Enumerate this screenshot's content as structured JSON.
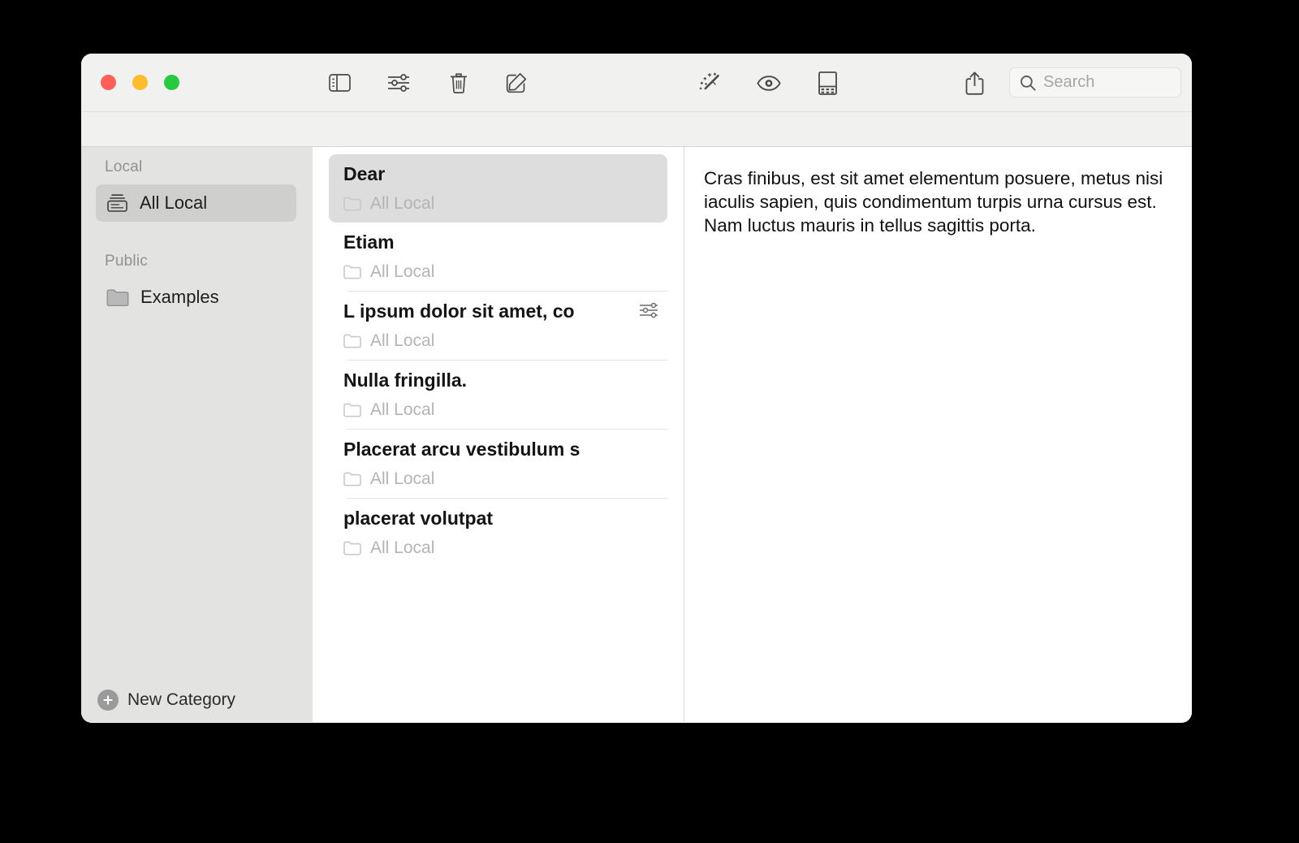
{
  "window": {
    "traffic_lights": [
      {
        "name": "close",
        "color": "#ff5f57"
      },
      {
        "name": "minimize",
        "color": "#febc2e"
      },
      {
        "name": "zoom",
        "color": "#28c840"
      }
    ]
  },
  "toolbar": {
    "buttons": [
      {
        "name": "toggle-sidebar",
        "icon": "sidebar-icon"
      },
      {
        "name": "filter",
        "icon": "sliders-icon"
      },
      {
        "name": "delete",
        "icon": "trash-icon"
      },
      {
        "name": "new-note",
        "icon": "compose-icon"
      },
      {
        "name": "magic",
        "icon": "magic-wand-icon"
      },
      {
        "name": "preview",
        "icon": "eye-icon"
      },
      {
        "name": "keyboard",
        "icon": "note-keyboard-icon"
      },
      {
        "name": "share",
        "icon": "share-icon"
      }
    ],
    "search": {
      "placeholder": "Search",
      "value": "",
      "icon": "search-icon"
    }
  },
  "sidebar": {
    "sections": [
      {
        "title": "Local",
        "items": [
          {
            "label": "All Local",
            "icon": "archive-tray-icon",
            "selected": true
          }
        ]
      },
      {
        "title": "Public",
        "items": [
          {
            "label": "Examples",
            "icon": "folder-icon",
            "selected": false
          }
        ]
      }
    ],
    "new_category": {
      "label": "New Category",
      "icon": "plus-circle-icon"
    }
  },
  "list": {
    "items": [
      {
        "title": "Dear",
        "folder": "All Local",
        "selected": true,
        "has_filter_icon": false
      },
      {
        "title": "Etiam",
        "folder": "All Local",
        "selected": false,
        "has_filter_icon": false
      },
      {
        "title": "L ipsum dolor sit amet, co",
        "folder": "All Local",
        "selected": false,
        "has_filter_icon": true
      },
      {
        "title": "Nulla fringilla.",
        "folder": "All Local",
        "selected": false,
        "has_filter_icon": false
      },
      {
        "title": "Placerat arcu vestibulum s",
        "folder": "All Local",
        "selected": false,
        "has_filter_icon": false
      },
      {
        "title": "placerat volutpat",
        "folder": "All Local",
        "selected": false,
        "has_filter_icon": false
      }
    ]
  },
  "detail": {
    "body": "Cras finibus, est sit amet elementum posuere, metus nisi iaculis sapien, quis condimentum turpis urna cursus est. Nam luctus mauris in tellus sagittis porta."
  },
  "colors": {
    "sidebar_bg": "#e3e3e1",
    "titlebar_bg": "#f1f1ef",
    "selection_sidebar": "#cfcfcd",
    "selection_list": "#dddddd",
    "muted_text": "#b4b4b4",
    "window_bg": "#ffffff",
    "page_bg": "#000000"
  }
}
